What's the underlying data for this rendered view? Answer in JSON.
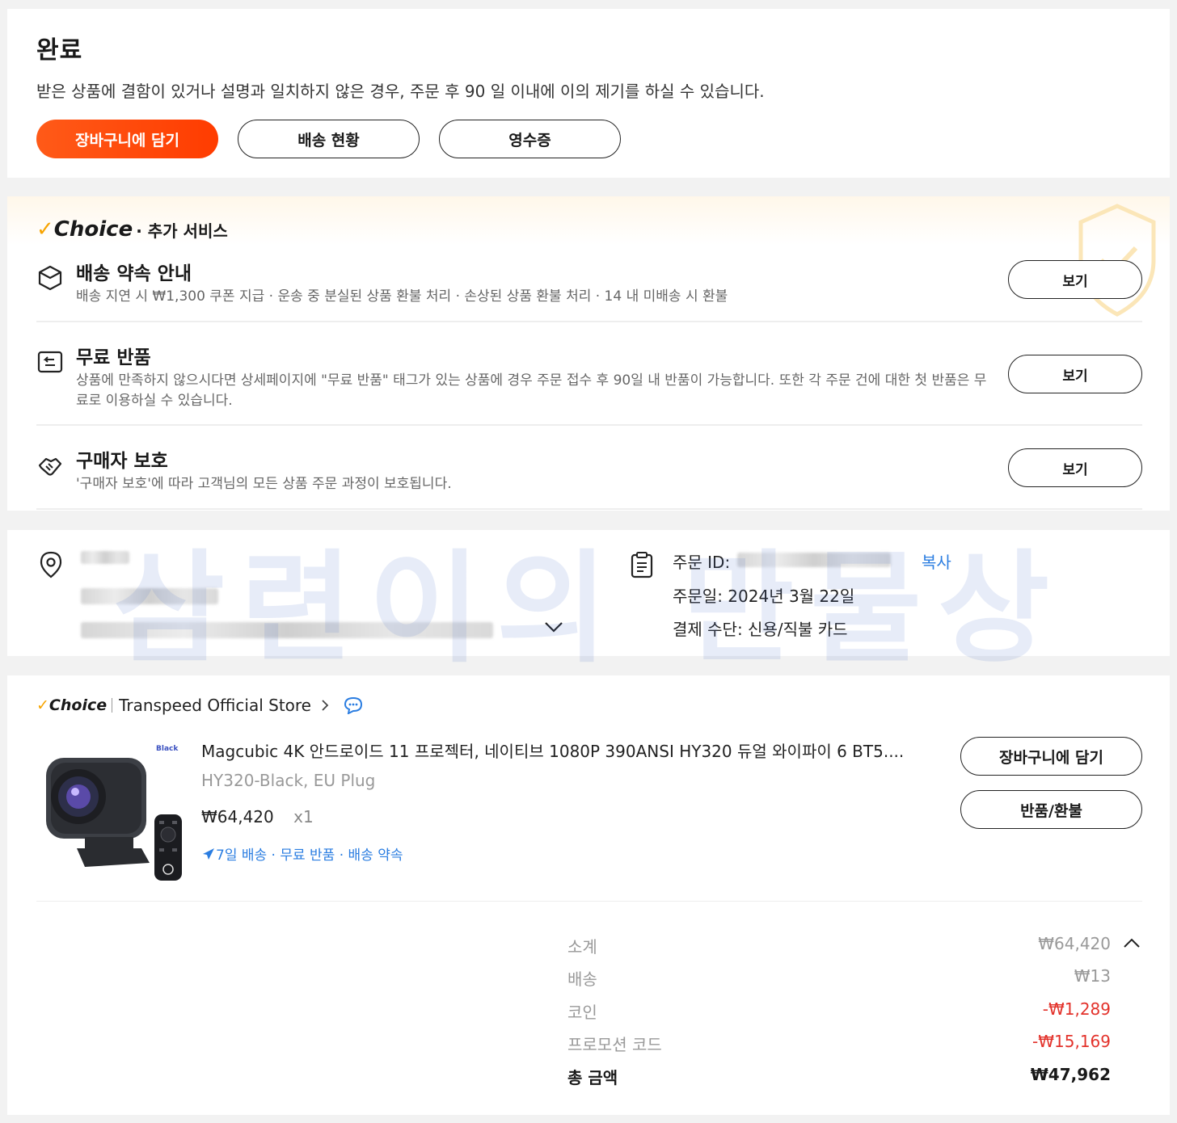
{
  "status": {
    "title": "완료",
    "description": "받은 상품에 결함이 있거나 설명과 일치하지 않은 경우, 주문 후 90 일 이내에 이의 제기를 하실 수 있습니다.",
    "buttons": {
      "add_to_cart": "장바구니에 담기",
      "tracking": "배송 현황",
      "receipt": "영수증"
    }
  },
  "choice": {
    "logo": "Choice",
    "subtitle": "· 추가 서비스",
    "services": [
      {
        "icon": "box-icon",
        "name": "배송 약속 안내",
        "text": "배송 지연 시 ₩1,300 쿠폰 지급 · 운송 중 분실된 상품 환불 처리 · 손상된 상품 환불 처리 · 14 내 미배송 시 환불",
        "button": "보기"
      },
      {
        "icon": "return-icon",
        "name": "무료 반품",
        "text": "상품에 만족하지 않으시다면 상세페이지에 \"무료 반품\" 태그가 있는 상품에 경우 주문 접수 후 90일 내 반품이 가능합니다. 또한 각 주문 건에 대한 첫 반품은 무료로 이용하실 수 있습니다.",
        "button": "보기"
      },
      {
        "icon": "handshake-icon",
        "name": "구매자 보호",
        "text": "'구매자 보호'에 따라 고객님의 모든 상품 주문 과정이 보호됩니다.",
        "button": "보기"
      }
    ]
  },
  "watermark": "삼련이의 만물상",
  "order": {
    "id_label": "주문 ID:",
    "copy": "복사",
    "date": "주문일: 2024년 3월 22일",
    "payment": "결제 수단: 신용/직불 카드"
  },
  "product": {
    "choice_logo": "Choice",
    "store_name": "Transpeed Official Store",
    "thumb_label": "Black",
    "title": "Magcubic 4K 안드로이드 11 프로젝터, 네이티브 1080P 390ANSI HY320 듀얼 와이파이 6 BT5....",
    "sku": "HY320-Black, EU Plug",
    "price": "₩64,420",
    "qty": "x1",
    "tags": "7일 배송 · 무료 반품 · 배송 약속",
    "buttons": {
      "add_to_cart": "장바구니에 담기",
      "refund": "반품/환불"
    }
  },
  "summary": [
    {
      "label": "소계",
      "value": "₩64,420"
    },
    {
      "label": "배송",
      "value": "₩13"
    },
    {
      "label": "코인",
      "value": "-₩1,289"
    },
    {
      "label": "프로모션 코드",
      "value": "-₩15,169"
    },
    {
      "label": "총 금액",
      "value": "₩47,962"
    }
  ],
  "colors": {
    "primary": "#ff4b0f",
    "link": "#2a7de1",
    "negative": "#e3322b",
    "choice": "#f7a400"
  }
}
